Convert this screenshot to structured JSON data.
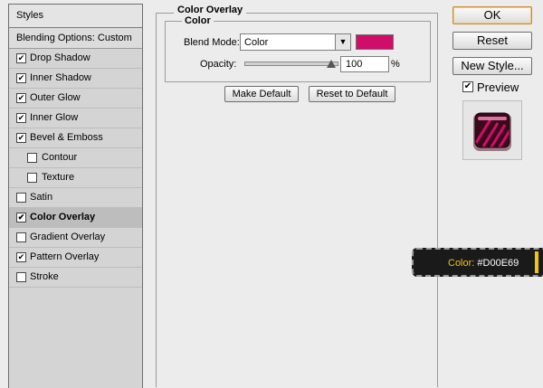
{
  "styles_panel": {
    "header": "Styles",
    "blending_options": "Blending Options: Custom",
    "items": [
      {
        "label": "Drop Shadow",
        "checked": true
      },
      {
        "label": "Inner Shadow",
        "checked": true
      },
      {
        "label": "Outer Glow",
        "checked": true
      },
      {
        "label": "Inner Glow",
        "checked": true
      },
      {
        "label": "Bevel & Emboss",
        "checked": true
      },
      {
        "label": "Contour",
        "checked": false
      },
      {
        "label": "Texture",
        "checked": false
      },
      {
        "label": "Satin",
        "checked": false
      },
      {
        "label": "Color Overlay",
        "checked": true
      },
      {
        "label": "Gradient Overlay",
        "checked": false
      },
      {
        "label": "Pattern Overlay",
        "checked": true
      },
      {
        "label": "Stroke",
        "checked": false
      }
    ],
    "selected": "Color Overlay"
  },
  "color_overlay": {
    "section_title": "Color Overlay",
    "group_title": "Color",
    "blend_mode_label": "Blend Mode:",
    "blend_mode_value": "Color",
    "swatch_color": "#D00E69",
    "opacity_label": "Opacity:",
    "opacity_value": "100",
    "opacity_unit": "%",
    "opacity_level": 1.0,
    "make_default": "Make Default",
    "reset_to_default": "Reset to Default"
  },
  "actions": {
    "ok": "OK",
    "reset": "Reset",
    "new_style": "New Style...",
    "preview_label": "Preview",
    "preview_checked": true
  },
  "tooltip": {
    "label": "Color:",
    "value": "#D00E69",
    "label_color": "#f1c40f",
    "value_color": "#ffffff"
  },
  "colors": {
    "accent_ok_border": "#c88a2e",
    "overlay_color": "#D00E69"
  }
}
